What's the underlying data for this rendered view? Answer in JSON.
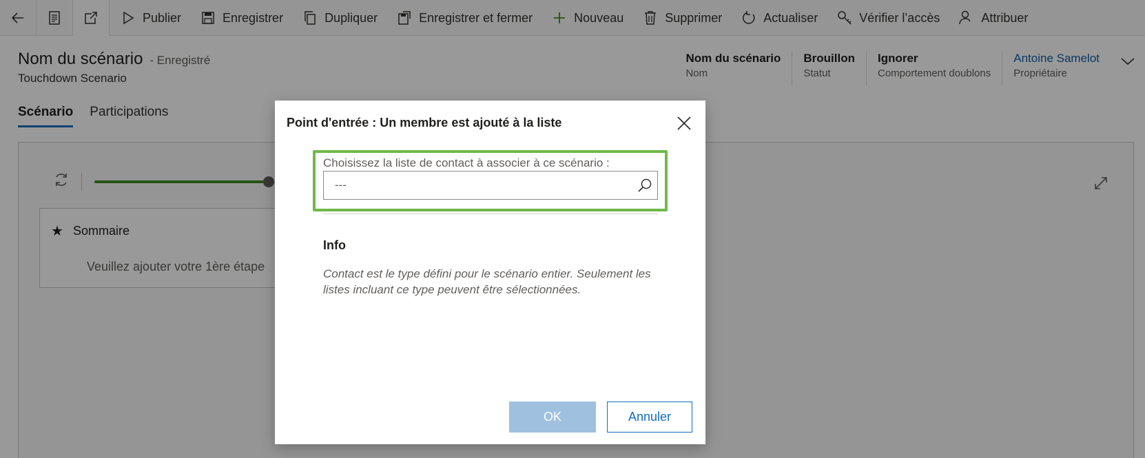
{
  "commandbar": {
    "icons": [
      "back-arrow-icon",
      "form-icon",
      "popout-icon"
    ],
    "items": [
      {
        "label": "Publier",
        "icon": "play-icon"
      },
      {
        "label": "Enregistrer",
        "icon": "save-icon"
      },
      {
        "label": "Dupliquer",
        "icon": "copy-icon"
      },
      {
        "label": "Enregistrer et fermer",
        "icon": "save-close-icon"
      },
      {
        "label": "Nouveau",
        "icon": "plus-icon"
      },
      {
        "label": "Supprimer",
        "icon": "trash-icon"
      },
      {
        "label": "Actualiser",
        "icon": "refresh-icon"
      },
      {
        "label": "Vérifier l’accès",
        "icon": "key-icon"
      },
      {
        "label": "Attribuer",
        "icon": "person-icon"
      }
    ]
  },
  "header": {
    "title": "Nom du scénario",
    "status": "- Enregistré",
    "subtitle": "Touchdown Scenario",
    "fields": [
      {
        "value": "Nom du scénario",
        "label": "Nom"
      },
      {
        "value": "Brouillon",
        "label": "Statut"
      },
      {
        "value": "Ignorer",
        "label": "Comportement doublons"
      },
      {
        "value": "Antoine Samelot",
        "label": "Propriétaire"
      }
    ]
  },
  "tabs": [
    {
      "label": "Scénario",
      "selected": true
    },
    {
      "label": "Participations",
      "selected": false
    }
  ],
  "canvas": {
    "zoom_slider_level": 1.0,
    "card": {
      "title": "Sommaire",
      "placeholder": "Veuillez ajouter votre 1ère étape"
    }
  },
  "dialog": {
    "title": "Point d'entrée : Un membre est ajouté à la liste",
    "field_label": "Choisissez la liste de contact à associer à ce scénario :",
    "field_placeholder": "---",
    "info_title": "Info",
    "info_text": "Contact est le type défini pour le scénario entier. Seulement les listes incluant ce type peuvent être sélectionnées.",
    "ok_label": "OK",
    "cancel_label": "Annuler"
  },
  "colors": {
    "accent": "#0f6cbd",
    "highlight": "#70b84a",
    "slider": "#3e8a22",
    "ok_disabled": "#9fc0df"
  }
}
